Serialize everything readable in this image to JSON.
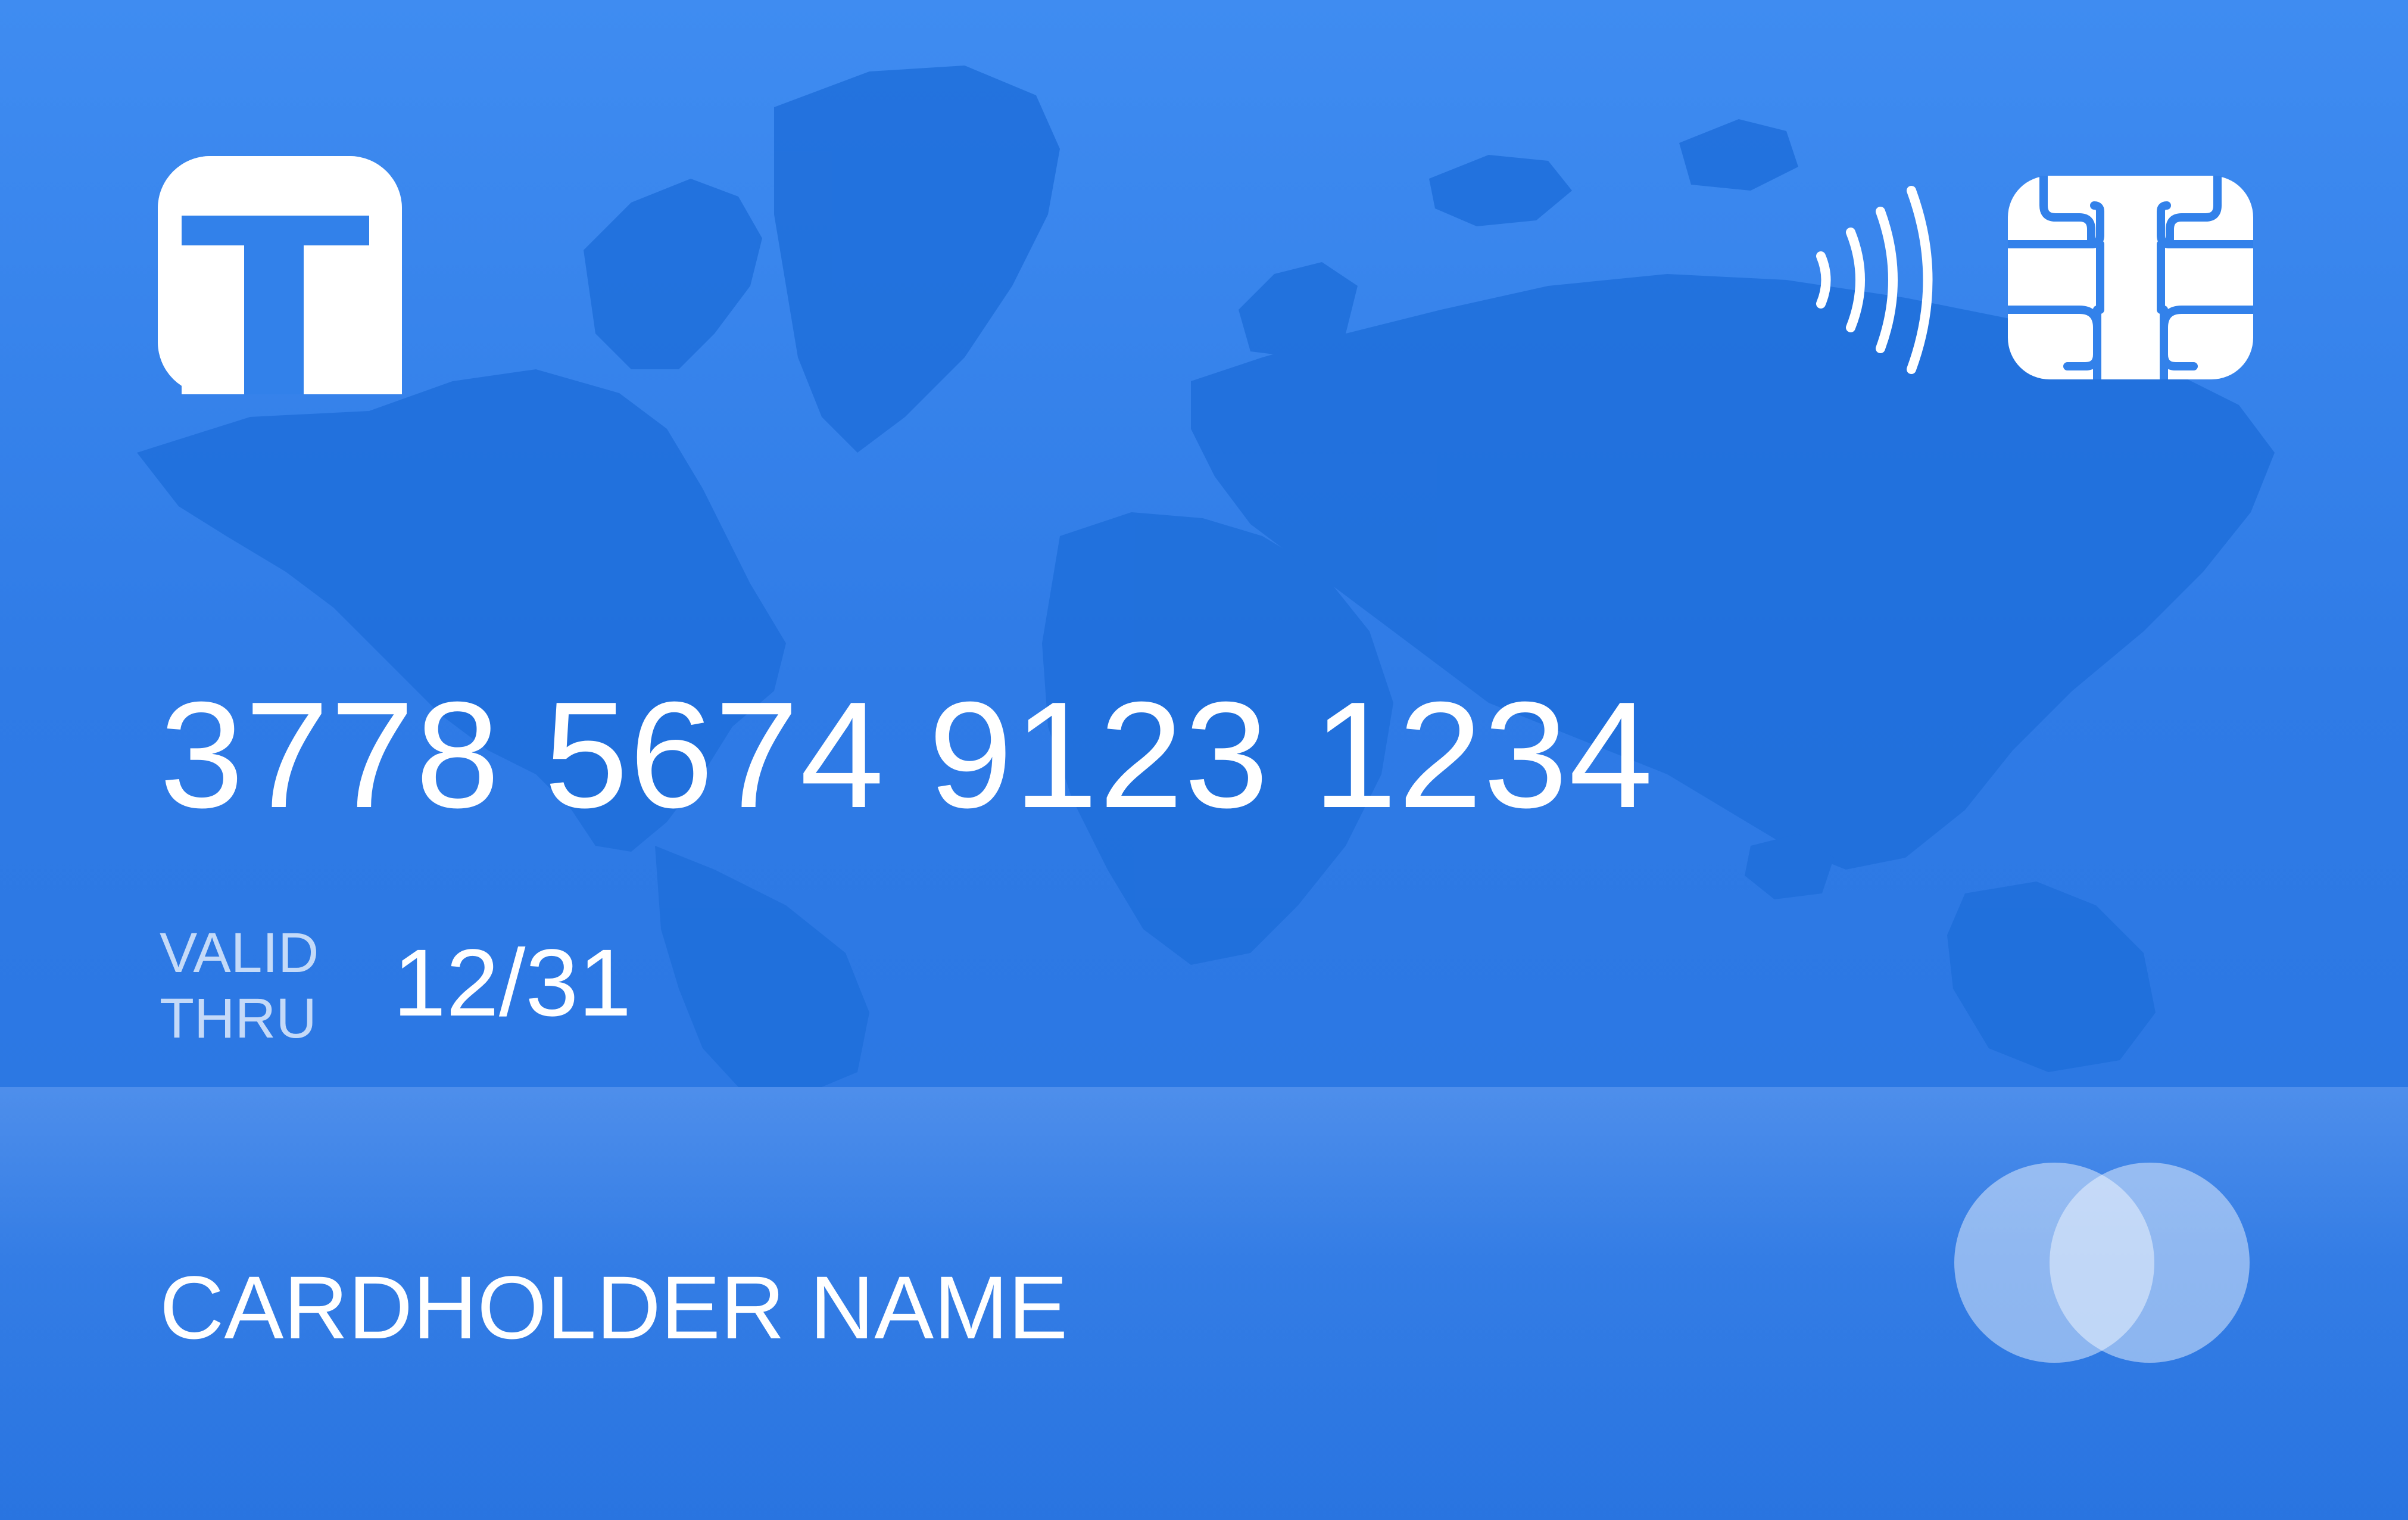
{
  "card": {
    "number": "3778 5674 9123 1234",
    "valid_thru_line1": "VALID",
    "valid_thru_line2": "THRU",
    "expiry": "12/31",
    "holder_name": "CARDHOLDER NAME"
  },
  "icons": {
    "logo": "bank-logo-icon",
    "contactless": "contactless-icon",
    "chip": "emv-chip-icon",
    "brand": "card-network-circles-icon"
  },
  "colors": {
    "background": "#3b86ee",
    "map": "#1f6fdb",
    "text": "#ffffff"
  }
}
